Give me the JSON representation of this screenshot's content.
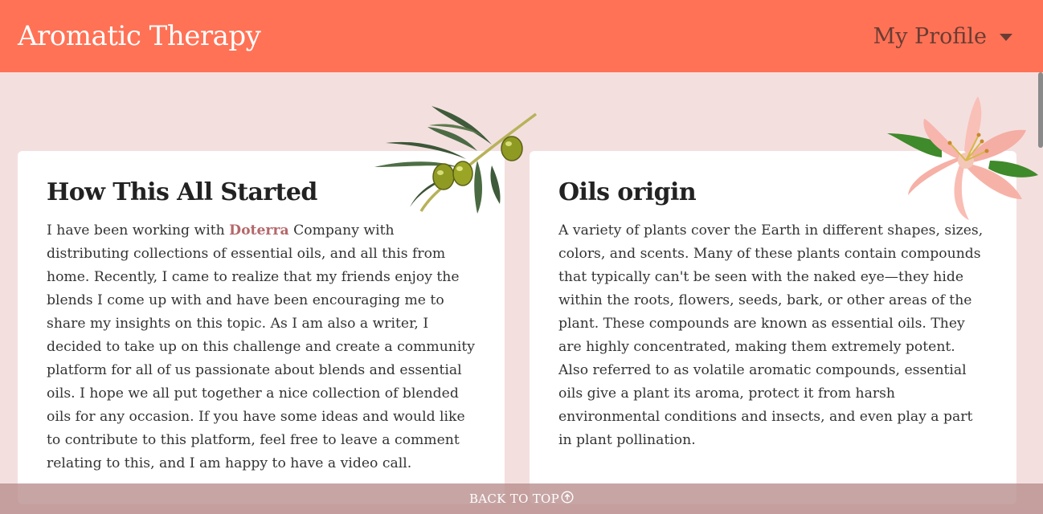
{
  "navbar": {
    "brand": "Aromatic Therapy",
    "profile_label": "My Profile",
    "profile_icon": "caret-down-icon"
  },
  "cards": [
    {
      "title": "How This All Started",
      "text_before_link": "I have been working with ",
      "link_text": "Doterra",
      "text_after_link": " Company with distributing collections of essential oils, and all this from home. Recently, I came to realize that my friends enjoy the blends I come up with and have been encouraging me to share my insights on this topic. As I am also a writer, I decided to take up on this challenge and create a community platform for all of us passionate about blends and essential oils. I hope we all put together a nice collection of blended oils for any occasion. If you have some ideas and would like to contribute to this platform, feel free to leave a comment relating to this, and I am happy to have a video call.",
      "decoration": "olive-branch"
    },
    {
      "title": "Oils origin",
      "text": "A variety of plants cover the Earth in different shapes, sizes, colors, and scents. Many of these plants contain compounds that typically can't be seen with the naked eye—they hide within the roots, flowers, seeds, bark, or other areas of the plant. These compounds are known as essential oils. They are highly concentrated, making them extremely potent. Also referred to as volatile aromatic compounds, essential oils give a plant its aroma, protect it from harsh environmental conditions and insects, and even play a part in plant pollination.",
      "decoration": "lily-flower"
    }
  ],
  "footer": {
    "back_to_top": "BACK TO TOP",
    "icon": "arrow-up-circle-icon"
  },
  "colors": {
    "navbar": "#ff7256",
    "page_background": "#f4dfdf",
    "link": "#b5676a",
    "footer_bar": "#b78c8c"
  }
}
